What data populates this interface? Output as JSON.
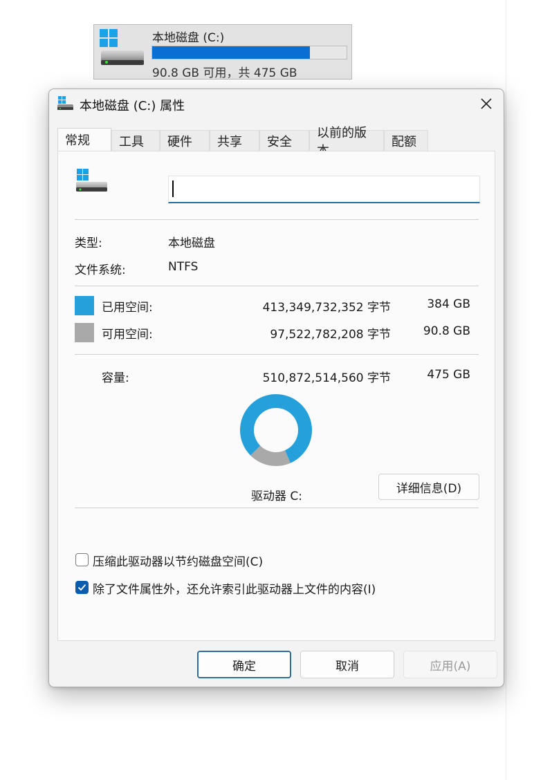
{
  "drive_tile": {
    "name": "本地磁盘 (C:)",
    "usage_fraction": 0.81,
    "free_text": "90.8 GB 可用，共 475 GB",
    "bar_color": "#0a6fd3"
  },
  "dialog": {
    "title": "本地磁盘 (C:) 属性",
    "tabs": [
      {
        "label": "常规",
        "active": true
      },
      {
        "label": "工具"
      },
      {
        "label": "硬件"
      },
      {
        "label": "共享"
      },
      {
        "label": "安全"
      },
      {
        "label": "以前的版本"
      },
      {
        "label": "配额"
      }
    ],
    "general": {
      "volume_label_value": "",
      "type_label": "类型:",
      "type_value": "本地磁盘",
      "fs_label": "文件系统:",
      "fs_value": "NTFS",
      "used": {
        "label": "已用空间:",
        "bytes": "413,349,732,352 字节",
        "size": "384 GB",
        "color": "#26a0da"
      },
      "free": {
        "label": "可用空间:",
        "bytes": "97,522,782,208 字节",
        "size": "90.8 GB",
        "color": "#a9a9a9"
      },
      "capacity": {
        "label": "容量:",
        "bytes": "510,872,514,560 字节",
        "size": "475 GB"
      },
      "drive_label": "驱动器 C:",
      "details_button": "详细信息(D)",
      "compress_label": "压缩此驱动器以节约磁盘空间(C)",
      "compress_checked": false,
      "index_label": "除了文件属性外，还允许索引此驱动器上文件的内容(I)",
      "index_checked": true
    },
    "buttons": {
      "ok": "确定",
      "cancel": "取消",
      "apply": "应用(A)"
    }
  }
}
